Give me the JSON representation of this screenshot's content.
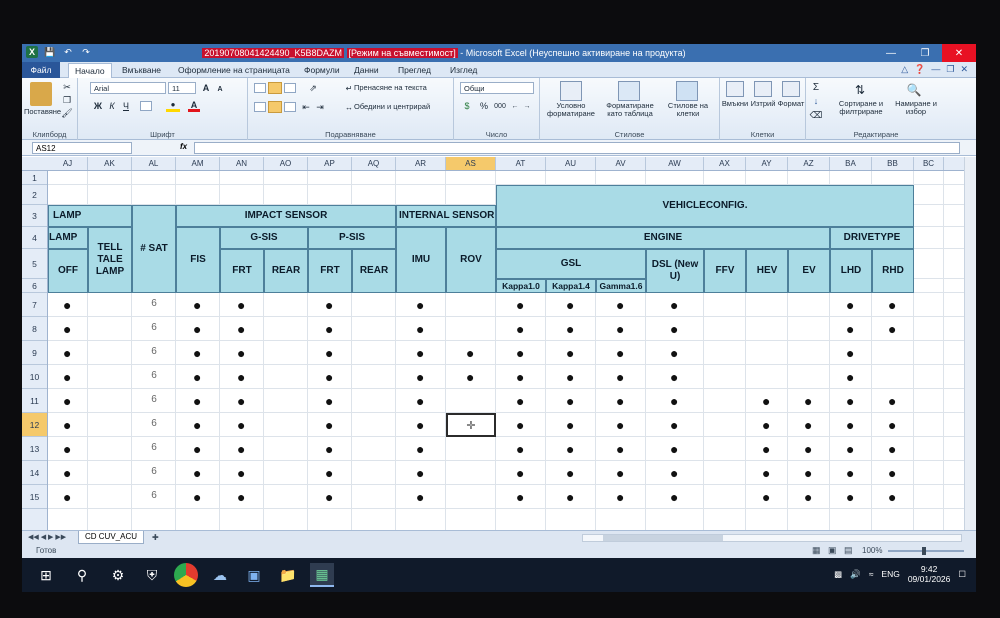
{
  "titlebar": {
    "filename": "20190708041424490_K5B8DAZM",
    "mode": "[Режим на съвместимост]",
    "app": "- Microsoft Excel (Неуспешно активиране на продукта)"
  },
  "tabs": [
    "Файл",
    "Начало",
    "Вмъкване",
    "Оформление на страницата",
    "Формули",
    "Данни",
    "Преглед",
    "Изглед"
  ],
  "ribbon": {
    "clipboard": {
      "paste": "Поставяне",
      "group": "Клипборд"
    },
    "font": {
      "name": "Arial",
      "size": "11",
      "group": "Шрифт"
    },
    "alignment": {
      "wrap": "Пренасяне на текста",
      "merge": "Обедини и центрирай",
      "group": "Подравняване"
    },
    "number": {
      "format": "Общи",
      "group": "Число"
    },
    "styles": {
      "conditional": "Условно форматиране",
      "as_table": "Форматиране като таблица",
      "cell_styles": "Стилове на клетки",
      "group": "Стилове"
    },
    "cells": {
      "insert": "Вмъкни",
      "delete": "Изтрий",
      "format": "Формат",
      "group": "Клетки"
    },
    "editing": {
      "sort": "Сортиране и филтриране",
      "find": "Намиране и избор",
      "group": "Редактиране"
    }
  },
  "formula_bar": {
    "name_box": "AS12",
    "fx": "fx",
    "value": ""
  },
  "columns": [
    "AJ",
    "AK",
    "AL",
    "AM",
    "AN",
    "AO",
    "AP",
    "AQ",
    "AR",
    "AS",
    "AT",
    "AU",
    "AV",
    "AW",
    "AX",
    "AY",
    "AZ",
    "BA",
    "BB",
    "BC"
  ],
  "rows": [
    "1",
    "2",
    "3",
    "4",
    "5",
    "6",
    "7",
    "8",
    "9",
    "10",
    "11",
    "12",
    "13",
    "14",
    "15"
  ],
  "headers": {
    "lamp": "LAMP",
    "lamp_cut": "LAMP",
    "off": "OFF",
    "tell_tale": "TELL TALE LAMP",
    "sat": "# SAT",
    "impact_sensor": "IMPACT SENSOR",
    "fis": "FIS",
    "g_sis": "G-SIS",
    "p_sis": "P-SIS",
    "frt": "FRT",
    "rear": "REAR",
    "internal_sensor": "INTERNAL SENSOR",
    "imu": "IMU",
    "rov": "ROV",
    "vehicle_config": "VEHICLECONFIG.",
    "engine": "ENGINE",
    "gsl": "GSL",
    "kappa10": "Kappa1.0",
    "kappa14": "Kappa1.4",
    "gamma16": "Gamma1.6",
    "dsl": "DSL (New U)",
    "ffv": "FFV",
    "hev": "HEV",
    "ev": "EV",
    "drivetype": "DRIVETYPE",
    "lhd": "LHD",
    "rhd": "RHD"
  },
  "sat_values": [
    "6",
    "6",
    "6",
    "6",
    "6",
    "6",
    "6",
    "6",
    "6",
    "6"
  ],
  "dot_glyph": "●",
  "dots": {
    "AJ": [
      7,
      8,
      9,
      10,
      11,
      12,
      13,
      14,
      15
    ],
    "AM": [
      7,
      8,
      9,
      10,
      11,
      12,
      13,
      14,
      15
    ],
    "AN": [
      7,
      8,
      9,
      10,
      11,
      12,
      13,
      14,
      15
    ],
    "AP": [
      7,
      8,
      9,
      10,
      11,
      12,
      13,
      14,
      15
    ],
    "AR": [
      7,
      8,
      9,
      10,
      11,
      12,
      13,
      14,
      15
    ],
    "AS": [
      9,
      10
    ],
    "AT": [
      7,
      8,
      9,
      10,
      11,
      12,
      13,
      14,
      15
    ],
    "AU": [
      7,
      8,
      9,
      10,
      11,
      12,
      13,
      14,
      15
    ],
    "AV": [
      7,
      8,
      9,
      10,
      11,
      12,
      13,
      14,
      15
    ],
    "AW": [
      7,
      8,
      9,
      10,
      11,
      12,
      13,
      14,
      15
    ],
    "AY": [
      11,
      12,
      13,
      14,
      15
    ],
    "AZ": [
      11,
      12,
      13,
      14,
      15
    ],
    "BA": [
      7,
      8,
      9,
      10,
      11,
      12,
      13,
      14,
      15
    ],
    "BB": [
      7,
      8,
      11,
      12,
      13,
      14,
      15
    ]
  },
  "sheet_tab": "CD CUV_ACU",
  "status": {
    "ready": "Готов",
    "zoom": "100%"
  },
  "taskbar": {
    "lang": "ENG",
    "time": "9:42",
    "date": "09/01/2026"
  },
  "colors": {
    "header_fill": "#a9dbe6",
    "accent": "#2a5699",
    "selected_col": "#f5c96b"
  }
}
